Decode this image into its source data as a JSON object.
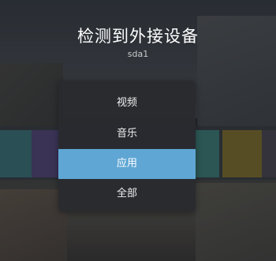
{
  "dialog": {
    "title": "检测到外接设备",
    "device_name": "sda1"
  },
  "menu": {
    "selected_index": 2,
    "highlight_color": "#5fa6d4",
    "items": [
      {
        "label": "视频"
      },
      {
        "label": "音乐"
      },
      {
        "label": "应用"
      },
      {
        "label": "全部"
      }
    ]
  }
}
